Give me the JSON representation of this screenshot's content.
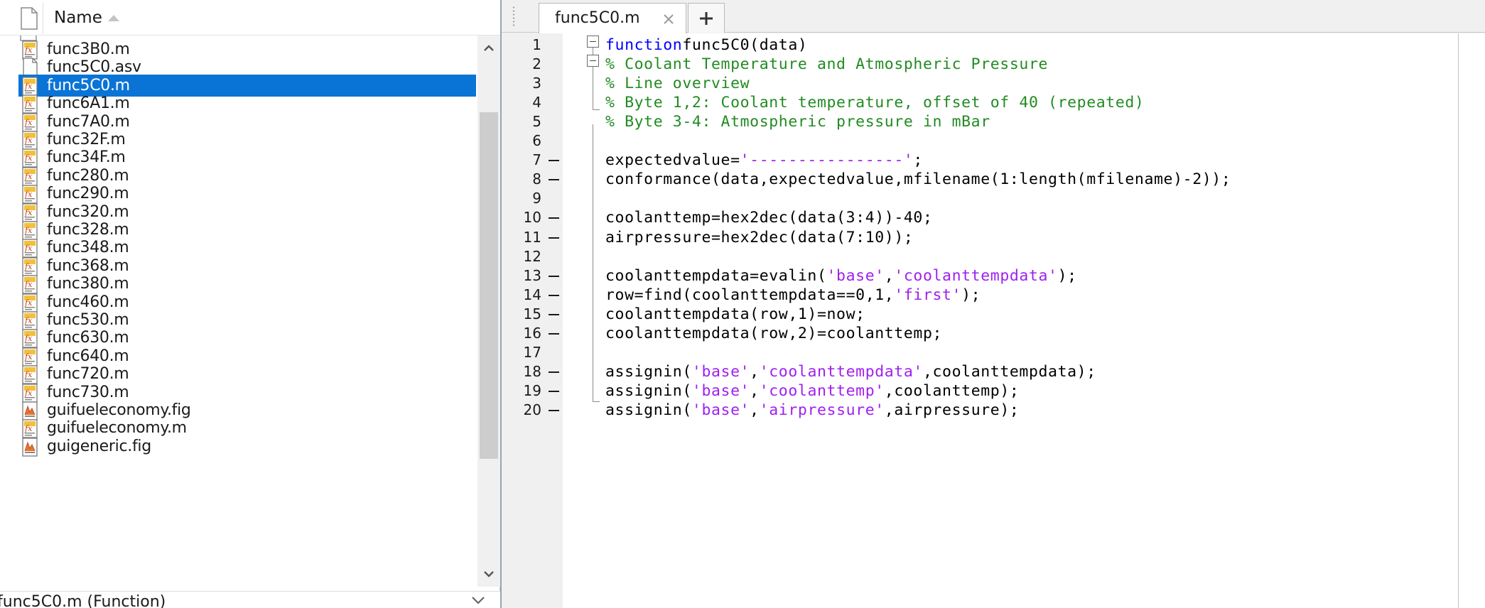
{
  "browser": {
    "header": {
      "name_label": "Name"
    },
    "files": [
      {
        "name": "func3B0.m",
        "type": "m"
      },
      {
        "name": "func5C0.asv",
        "type": "asv"
      },
      {
        "name": "func5C0.m",
        "type": "m",
        "selected": true
      },
      {
        "name": "func6A1.m",
        "type": "m"
      },
      {
        "name": "func7A0.m",
        "type": "m"
      },
      {
        "name": "func32F.m",
        "type": "m"
      },
      {
        "name": "func34F.m",
        "type": "m"
      },
      {
        "name": "func280.m",
        "type": "m"
      },
      {
        "name": "func290.m",
        "type": "m"
      },
      {
        "name": "func320.m",
        "type": "m"
      },
      {
        "name": "func328.m",
        "type": "m"
      },
      {
        "name": "func348.m",
        "type": "m"
      },
      {
        "name": "func368.m",
        "type": "m"
      },
      {
        "name": "func380.m",
        "type": "m"
      },
      {
        "name": "func460.m",
        "type": "m"
      },
      {
        "name": "func530.m",
        "type": "m"
      },
      {
        "name": "func630.m",
        "type": "m"
      },
      {
        "name": "func640.m",
        "type": "m"
      },
      {
        "name": "func720.m",
        "type": "m"
      },
      {
        "name": "func730.m",
        "type": "m"
      },
      {
        "name": "guifueleconomy.fig",
        "type": "fig"
      },
      {
        "name": "guifueleconomy.m",
        "type": "m"
      },
      {
        "name": "guigeneric.fig",
        "type": "fig"
      }
    ],
    "status_text": "func5C0.m  (Function)"
  },
  "editor": {
    "tab_title": "func5C0.m",
    "lines": [
      {
        "n": "1",
        "exec": false,
        "segs": [
          [
            "kw",
            "function"
          ],
          [
            "",
            "func5C0(data)"
          ]
        ]
      },
      {
        "n": "2",
        "exec": false,
        "segs": [
          [
            "cm",
            "% Coolant Temperature and Atmospheric Pressure"
          ]
        ]
      },
      {
        "n": "3",
        "exec": false,
        "segs": [
          [
            "cm",
            "% Line overview"
          ]
        ]
      },
      {
        "n": "4",
        "exec": false,
        "segs": [
          [
            "cm",
            "% Byte 1,2: Coolant temperature, offset of 40 (repeated)"
          ]
        ]
      },
      {
        "n": "5",
        "exec": false,
        "segs": [
          [
            "cm",
            "% Byte 3-4: Atmospheric pressure in mBar"
          ]
        ]
      },
      {
        "n": "6",
        "exec": false,
        "segs": []
      },
      {
        "n": "7",
        "exec": true,
        "segs": [
          [
            "",
            "expectedvalue="
          ],
          [
            "st",
            "'----------------'"
          ],
          [
            "",
            ";"
          ]
        ]
      },
      {
        "n": "8",
        "exec": true,
        "segs": [
          [
            "",
            "conformance(data,expectedvalue,mfilename(1:length(mfilename)-2));"
          ]
        ]
      },
      {
        "n": "9",
        "exec": false,
        "segs": []
      },
      {
        "n": "10",
        "exec": true,
        "segs": [
          [
            "",
            "coolanttemp=hex2dec(data(3:4))-40;"
          ]
        ]
      },
      {
        "n": "11",
        "exec": true,
        "segs": [
          [
            "",
            "airpressure=hex2dec(data(7:10));"
          ]
        ]
      },
      {
        "n": "12",
        "exec": false,
        "segs": []
      },
      {
        "n": "13",
        "exec": true,
        "segs": [
          [
            "",
            "coolanttempdata=evalin("
          ],
          [
            "st",
            "'base'"
          ],
          [
            "",
            ","
          ],
          [
            "st",
            "'coolanttempdata'"
          ],
          [
            "",
            ");"
          ]
        ]
      },
      {
        "n": "14",
        "exec": true,
        "segs": [
          [
            "",
            "row=find(coolanttempdata==0,1,"
          ],
          [
            "st",
            "'first'"
          ],
          [
            "",
            ");"
          ]
        ]
      },
      {
        "n": "15",
        "exec": true,
        "segs": [
          [
            "",
            "coolanttempdata(row,1)=now;"
          ]
        ]
      },
      {
        "n": "16",
        "exec": true,
        "segs": [
          [
            "",
            "coolanttempdata(row,2)=coolanttemp;"
          ]
        ]
      },
      {
        "n": "17",
        "exec": false,
        "segs": []
      },
      {
        "n": "18",
        "exec": true,
        "segs": [
          [
            "",
            "assignin("
          ],
          [
            "st",
            "'base'"
          ],
          [
            "",
            ","
          ],
          [
            "st",
            "'coolanttempdata'"
          ],
          [
            "",
            ",coolanttempdata);"
          ]
        ]
      },
      {
        "n": "19",
        "exec": true,
        "segs": [
          [
            "",
            "assignin("
          ],
          [
            "st",
            "'base'"
          ],
          [
            "",
            ","
          ],
          [
            "st",
            "'coolanttemp'"
          ],
          [
            "",
            ",coolanttemp);"
          ]
        ]
      },
      {
        "n": "20",
        "exec": true,
        "segs": [
          [
            "",
            "assignin("
          ],
          [
            "st",
            "'base'"
          ],
          [
            "",
            ","
          ],
          [
            "st",
            "'airpressure'"
          ],
          [
            "",
            ",airpressure);"
          ]
        ]
      }
    ]
  },
  "colors": {
    "selection": "#0a74d6",
    "keyword": "#0000ff",
    "comment": "#228b22",
    "string": "#a020f0"
  },
  "icons": {
    "header_page": "page-icon",
    "sort": "sort-ascending-icon",
    "m_file": "m-file-icon",
    "asv_file": "blank-file-icon",
    "fig_file": "fig-file-icon",
    "tab_close": "close-icon",
    "tab_add": "plus-icon"
  }
}
